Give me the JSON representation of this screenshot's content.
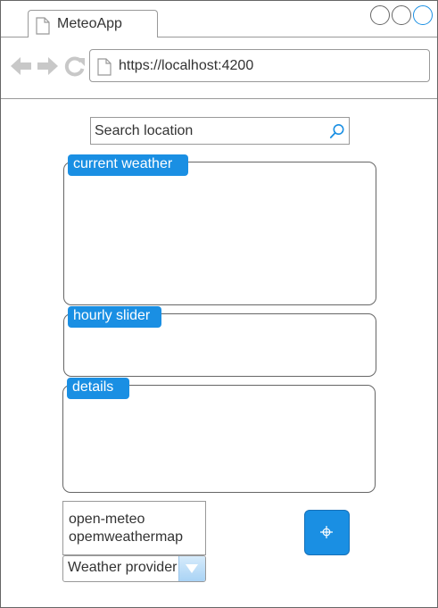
{
  "browser": {
    "tab_title": "MeteoApp",
    "url": "https://localhost:4200",
    "controls": [
      "minimize-circle",
      "maximize-circle",
      "close-circle"
    ],
    "nav_icons": [
      "back-arrow-icon",
      "forward-arrow-icon",
      "refresh-icon"
    ]
  },
  "search": {
    "placeholder": "Search location",
    "icon": "search-icon"
  },
  "panels": {
    "current_weather": "current weather",
    "hourly_slider": "hourly slider",
    "details": "details"
  },
  "provider": {
    "options": [
      "open-meteo",
      "opemweathermap"
    ],
    "select_label": "Weather provider"
  },
  "locate_button": {
    "icon": "crosshair-icon"
  },
  "colors": {
    "accent": "#1a8fe3",
    "border": "#666666",
    "nav_icon": "#c8c8c8"
  }
}
